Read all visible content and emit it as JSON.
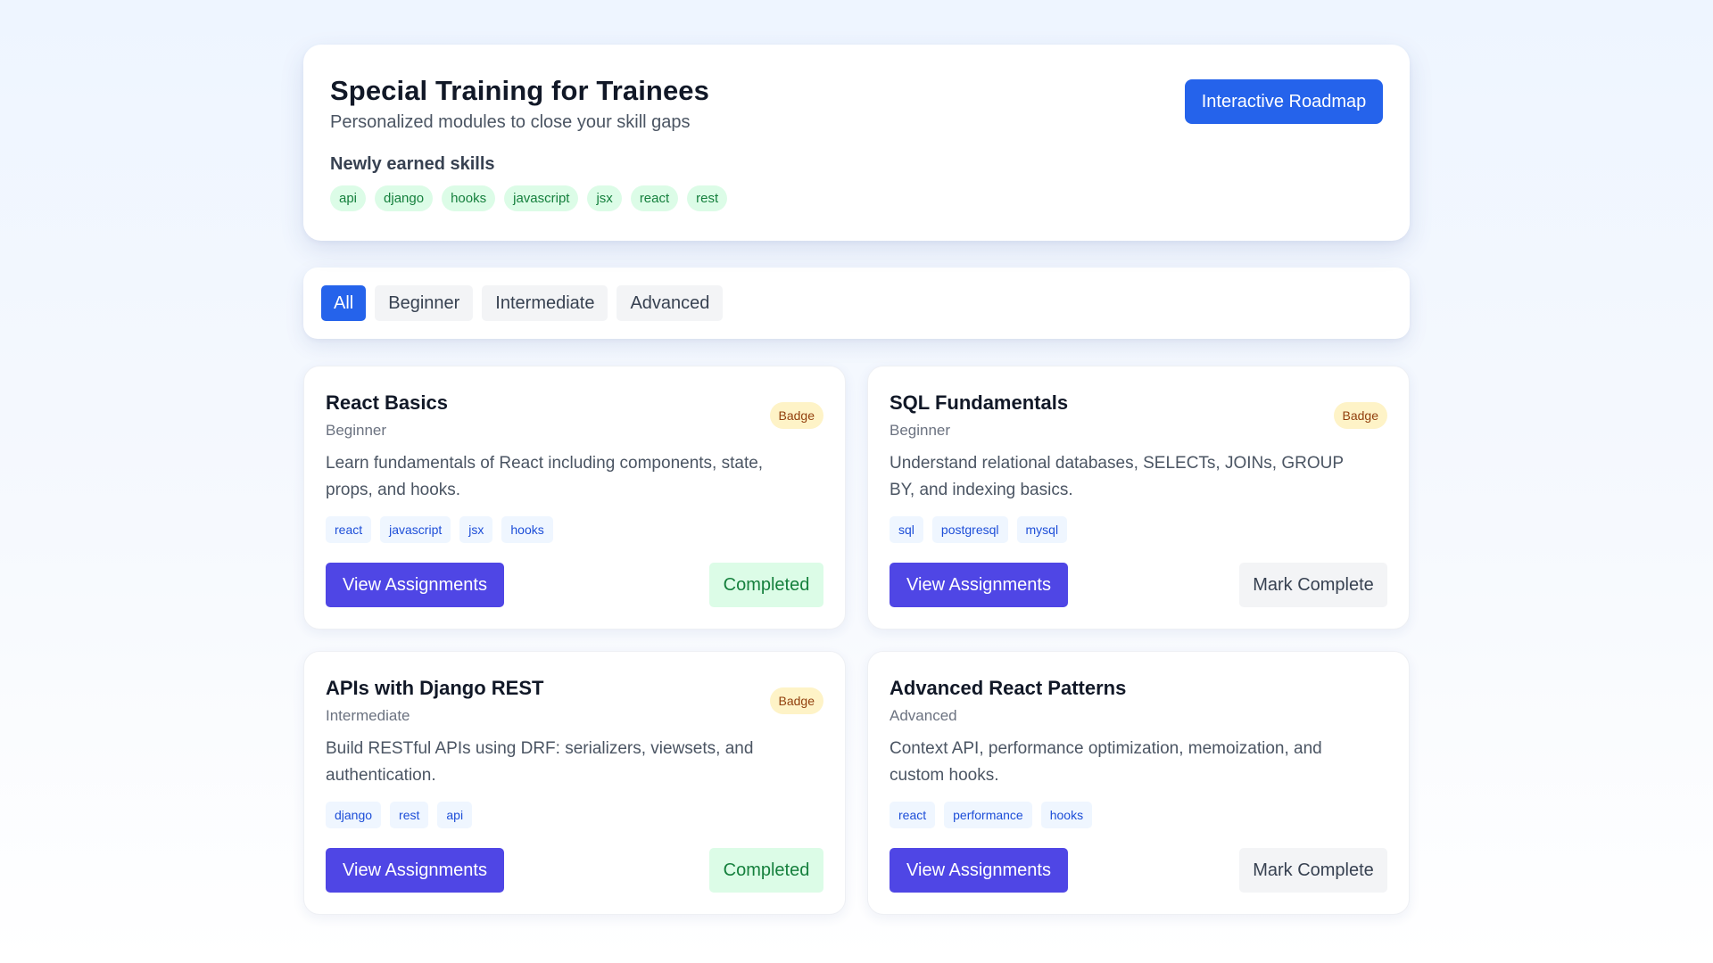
{
  "header": {
    "title": "Special Training for Trainees",
    "subtitle": "Personalized modules to close your skill gaps",
    "roadmap_button": "Interactive Roadmap",
    "skills_heading": "Newly earned skills",
    "skills": [
      "api",
      "django",
      "hooks",
      "javascript",
      "jsx",
      "react",
      "rest"
    ]
  },
  "filters": {
    "items": [
      "All",
      "Beginner",
      "Intermediate",
      "Advanced"
    ],
    "selected": "All"
  },
  "modules": [
    {
      "title": "React Basics",
      "level": "Beginner",
      "badge": "Badge",
      "description": "Learn fundamentals of React including components, state, props, and hooks.",
      "tags": [
        "react",
        "javascript",
        "jsx",
        "hooks"
      ],
      "primary_action": "View Assignments",
      "status_label": "Completed",
      "completed": true
    },
    {
      "title": "SQL Fundamentals",
      "level": "Beginner",
      "badge": "Badge",
      "description": "Understand relational databases, SELECTs, JOINs, GROUP BY, and indexing basics.",
      "tags": [
        "sql",
        "postgresql",
        "mysql"
      ],
      "primary_action": "View Assignments",
      "status_label": "Mark Complete",
      "completed": false
    },
    {
      "title": "APIs with Django REST",
      "level": "Intermediate",
      "badge": "Badge",
      "description": "Build RESTful APIs using DRF: serializers, viewsets, and authentication.",
      "tags": [
        "django",
        "rest",
        "api"
      ],
      "primary_action": "View Assignments",
      "status_label": "Completed",
      "completed": true
    },
    {
      "title": "Advanced React Patterns",
      "level": "Advanced",
      "badge": "",
      "description": "Context API, performance optimization, memoization, and custom hooks.",
      "tags": [
        "react",
        "performance",
        "hooks"
      ],
      "primary_action": "View Assignments",
      "status_label": "Mark Complete",
      "completed": false
    }
  ],
  "colors": {
    "primary_blue": "#2563eb",
    "indigo": "#4f46e5",
    "success_bg": "#dcfce7",
    "success_text": "#15803d",
    "badge_bg": "#fef3c7",
    "tag_bg": "#eff6ff"
  }
}
